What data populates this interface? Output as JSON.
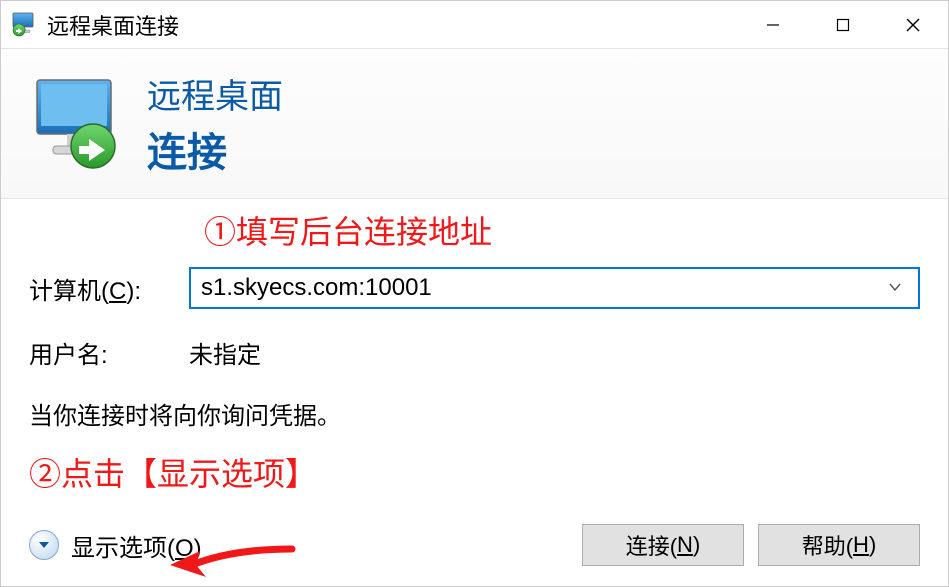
{
  "window": {
    "title": "远程桌面连接"
  },
  "header": {
    "line1": "远程桌面",
    "line2": "连接"
  },
  "annotations": {
    "step1": "①填写后台连接地址",
    "step2": "②点击【显示选项】"
  },
  "form": {
    "computer_label_pre": "计算机(",
    "computer_label_key": "C",
    "computer_label_post": "):",
    "computer_value": "s1.skyecs.com:10001",
    "username_label": "用户名:",
    "username_value": "未指定",
    "info": "当你连接时将向你询问凭据。"
  },
  "show_options": {
    "label_pre": "显示选项(",
    "label_key": "O",
    "label_post": ")"
  },
  "buttons": {
    "connect_pre": "连接(",
    "connect_key": "N",
    "connect_post": ")",
    "help_pre": "帮助(",
    "help_key": "H",
    "help_post": ")"
  }
}
